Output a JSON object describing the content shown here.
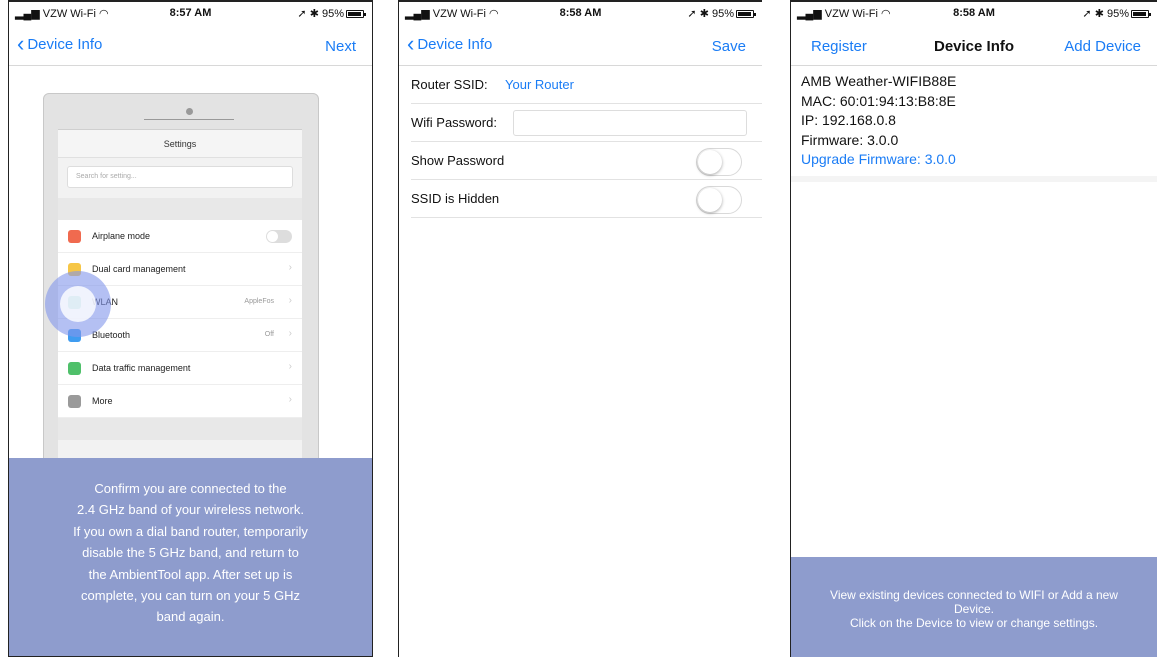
{
  "panels": [
    {
      "status": {
        "carrier": "VZW Wi-Fi",
        "time": "8:57 AM",
        "battery": "95%"
      },
      "nav": {
        "back_label": "Device Info",
        "right_label": "Next"
      },
      "illustration": {
        "title": "Settings",
        "search_placeholder": "Search for setting...",
        "rows": [
          {
            "label": "Airplane mode",
            "value": "",
            "color": "#f06a4f"
          },
          {
            "label": "Dual card management",
            "value": "",
            "color": "#f6c646"
          },
          {
            "label": "WLAN",
            "value": "AppleFos",
            "color": "#2fbf9e"
          },
          {
            "label": "Bluetooth",
            "value": "Off",
            "color": "#3f9cf0"
          },
          {
            "label": "Data traffic management",
            "value": "",
            "color": "#4fc06a"
          },
          {
            "label": "More",
            "value": "",
            "color": "#9a9a9a"
          }
        ]
      },
      "instructions": [
        "Confirm you are connected to the",
        "2.4 GHz band of your wireless network.",
        " If you own a dial band router, temporarily",
        "disable the 5 GHz band, and return to",
        "the AmbientTool app. After set up is",
        "complete, you can turn on your 5 GHz",
        "band again."
      ]
    },
    {
      "status": {
        "carrier": "VZW Wi-Fi",
        "time": "8:58 AM",
        "battery": "95%"
      },
      "nav": {
        "back_label": "Device Info",
        "right_label": "Save"
      },
      "form": {
        "ssid_label": "Router SSID:",
        "ssid_value": "Your Router",
        "password_label": "Wifi Password:",
        "password_value": "",
        "show_password_label": "Show Password",
        "ssid_hidden_label": "SSID is Hidden"
      }
    },
    {
      "status": {
        "carrier": "VZW Wi-Fi",
        "time": "8:58 AM",
        "battery": "95%"
      },
      "nav": {
        "left_label": "Register",
        "title": "Device Info",
        "right_label": "Add Device"
      },
      "device": {
        "name": "AMB Weather-WIFIB88E",
        "mac": "MAC: 60:01:94:13:B8:8E",
        "ip": "IP: 192.168.0.8",
        "firmware": "Firmware: 3.0.0",
        "upgrade": "Upgrade Firmware: 3.0.0"
      },
      "footer": [
        "View existing devices connected to WIFI or Add a new Device.",
        "Click on the Device to view or change settings."
      ]
    }
  ],
  "colors": {
    "accent": "#1a7cf5",
    "overlay": "#8e9ccd"
  }
}
